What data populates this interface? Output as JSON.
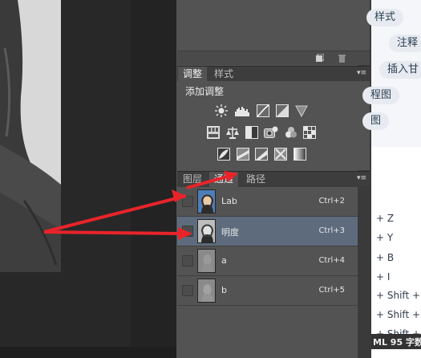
{
  "adjustments_panel": {
    "tabs": [
      "调整",
      "样式"
    ],
    "title": "添加调整"
  },
  "channels_panel": {
    "tabs": [
      "图层",
      "通道",
      "路径"
    ],
    "active_tab": "通道",
    "rows": [
      {
        "name": "Lab",
        "shortcut": "Ctrl+2",
        "selected": false
      },
      {
        "name": "明度",
        "shortcut": "Ctrl+3",
        "selected": true
      },
      {
        "name": "a",
        "shortcut": "Ctrl+4",
        "selected": false
      },
      {
        "name": "b",
        "shortcut": "Ctrl+5",
        "selected": false
      }
    ]
  },
  "web_page": {
    "pills": [
      "样式",
      "注释",
      "插入甘",
      "程图",
      "图"
    ],
    "shortcut_lines": [
      "+ Z",
      "+ Y",
      "+ B",
      "+ I",
      "+ Shift +",
      "+ Shift +",
      "+ Shift +"
    ],
    "status_bar": "ML 95 字数"
  },
  "colors": {
    "panel_bg": "#535353",
    "tab_bar": "#3d3d3d",
    "selected_row": "#5d6b7d",
    "arrow": "#e8242a"
  },
  "icons": {
    "top_footer": [
      "new-channel-icon",
      "delete-icon"
    ],
    "panel_menu": "panel-menu-icon",
    "adjustments": [
      "brightness-contrast-icon",
      "levels-icon",
      "curves-icon",
      "exposure-icon",
      "vibrance-icon",
      "hue-saturation-icon",
      "color-balance-icon",
      "black-white-icon",
      "photo-filter-icon",
      "channel-mixer-icon",
      "color-lookup-icon",
      "invert-icon",
      "posterize-icon",
      "threshold-icon",
      "selective-color-icon",
      "gradient-map-icon"
    ]
  }
}
